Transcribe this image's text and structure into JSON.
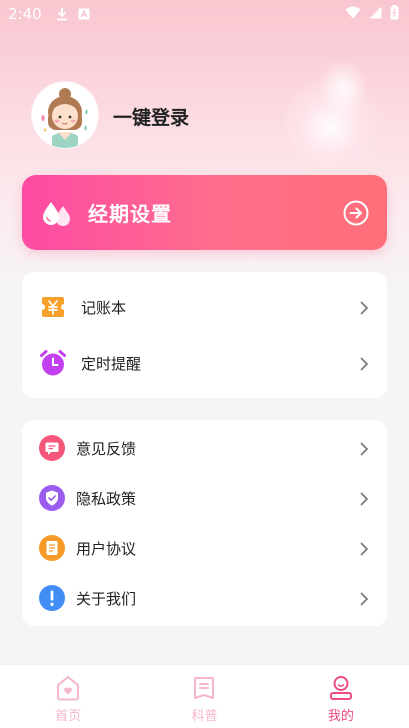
{
  "status_bar": {
    "time": "2:40",
    "icons": [
      "download-icon",
      "notification-a-icon",
      "wifi-icon",
      "signal-icon",
      "battery-icon"
    ]
  },
  "profile": {
    "avatar": "girl-avatar",
    "login_label": "一键登录"
  },
  "period_card": {
    "title": "经期设置",
    "icon": "drops-icon",
    "action_icon": "arrow-right-circle-icon",
    "gradient_start": "#fd4aa3",
    "gradient_end": "#ff6f79"
  },
  "tools": [
    {
      "label": "记账本",
      "icon": "yuan-ticket-icon",
      "color": "#f7a02a"
    },
    {
      "label": "定时提醒",
      "icon": "alarm-clock-icon",
      "color": "#c340f0"
    }
  ],
  "settings": [
    {
      "label": "意见反馈",
      "icon": "feedback-icon",
      "color": "#f5567c"
    },
    {
      "label": "隐私政策",
      "icon": "shield-check-icon",
      "color": "#9b5cf0"
    },
    {
      "label": "用户协议",
      "icon": "document-icon",
      "color": "#f79a2a"
    },
    {
      "label": "关于我们",
      "icon": "info-icon",
      "color": "#3f8df5"
    }
  ],
  "tab_bar": {
    "tabs": [
      {
        "label": "首页",
        "icon": "home-heart-icon",
        "active": false
      },
      {
        "label": "科普",
        "icon": "book-icon",
        "active": false
      },
      {
        "label": "我的",
        "icon": "profile-icon",
        "active": true
      }
    ],
    "active_color": "#ee4a86",
    "inactive_color": "#f6b8c8"
  }
}
